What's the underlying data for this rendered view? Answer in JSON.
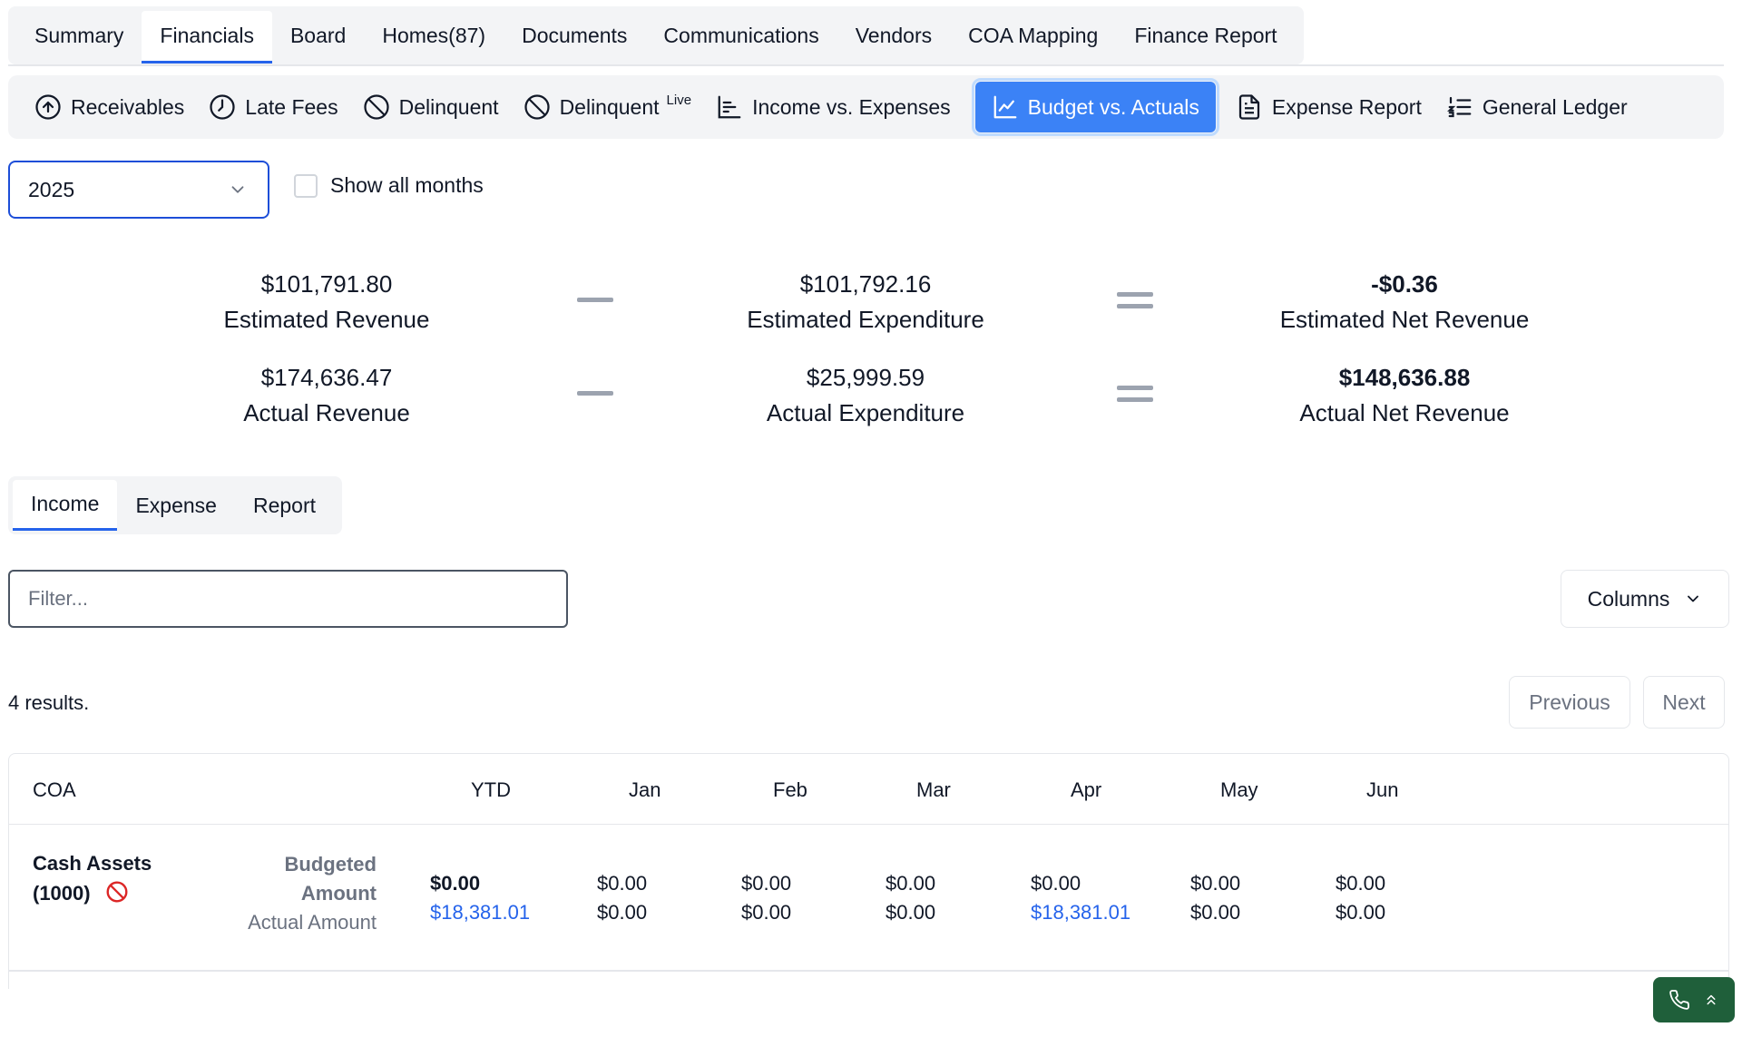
{
  "top_tabs": [
    {
      "label": "Summary"
    },
    {
      "label": "Financials"
    },
    {
      "label": "Board"
    },
    {
      "label": "Homes(87)"
    },
    {
      "label": "Documents"
    },
    {
      "label": "Communications"
    },
    {
      "label": "Vendors"
    },
    {
      "label": "COA Mapping"
    },
    {
      "label": "Finance Report"
    }
  ],
  "report_tabs": [
    {
      "label": "Receivables",
      "icon": "arrow-up-circle-icon"
    },
    {
      "label": "Late Fees",
      "icon": "clock-icon"
    },
    {
      "label": "Delinquent",
      "icon": "ban-icon"
    },
    {
      "label": "Delinquent",
      "badge": "Live",
      "icon": "ban-icon"
    },
    {
      "label": "Income vs. Expenses",
      "icon": "bar-chart-horizontal-icon"
    },
    {
      "label": "Budget vs. Actuals",
      "icon": "line-chart-icon"
    },
    {
      "label": "Expense Report",
      "icon": "document-icon"
    },
    {
      "label": "General Ledger",
      "icon": "list-ordered-icon"
    }
  ],
  "year_select": {
    "value": "2025"
  },
  "show_all_months": {
    "label": "Show all months",
    "checked": false
  },
  "summary": {
    "estimated_revenue": {
      "amount": "$101,791.80",
      "label": "Estimated Revenue"
    },
    "estimated_expenditure": {
      "amount": "$101,792.16",
      "label": "Estimated Expenditure"
    },
    "estimated_net": {
      "amount": "-$0.36",
      "label": "Estimated Net Revenue"
    },
    "actual_revenue": {
      "amount": "$174,636.47",
      "label": "Actual Revenue"
    },
    "actual_expenditure": {
      "amount": "$25,999.59",
      "label": "Actual Expenditure"
    },
    "actual_net": {
      "amount": "$148,636.88",
      "label": "Actual Net Revenue"
    }
  },
  "sub_tabs": [
    {
      "label": "Income"
    },
    {
      "label": "Expense"
    },
    {
      "label": "Report"
    }
  ],
  "filter": {
    "placeholder": "Filter...",
    "value": ""
  },
  "columns_button": {
    "label": "Columns"
  },
  "results_text": "4 results.",
  "pager": {
    "previous": "Previous",
    "next": "Next"
  },
  "table": {
    "headers": [
      "COA",
      "YTD",
      "Jan",
      "Feb",
      "Mar",
      "Apr",
      "May",
      "Jun"
    ],
    "rows": [
      {
        "coa_line1": "Cash Assets",
        "coa_line2": "(1000)",
        "label_budgeted": "Budgeted Amount",
        "label_budgeted_l1": "Budgeted",
        "label_budgeted_l2": "Amount",
        "label_actual": "Actual Amount",
        "cells": [
          {
            "budgeted": "$0.00",
            "actual": "$18,381.01"
          },
          {
            "budgeted": "$0.00",
            "actual": "$0.00"
          },
          {
            "budgeted": "$0.00",
            "actual": "$0.00"
          },
          {
            "budgeted": "$0.00",
            "actual": "$0.00"
          },
          {
            "budgeted": "$0.00",
            "actual": "$18,381.01"
          },
          {
            "budgeted": "$0.00",
            "actual": "$0.00"
          },
          {
            "budgeted": "$0.00",
            "actual": "$0.00"
          }
        ]
      }
    ]
  },
  "colors": {
    "accent": "#3b82f6",
    "link_blue": "#2563eb",
    "danger": "#dc2626",
    "fab_green": "#1f5f3a"
  }
}
